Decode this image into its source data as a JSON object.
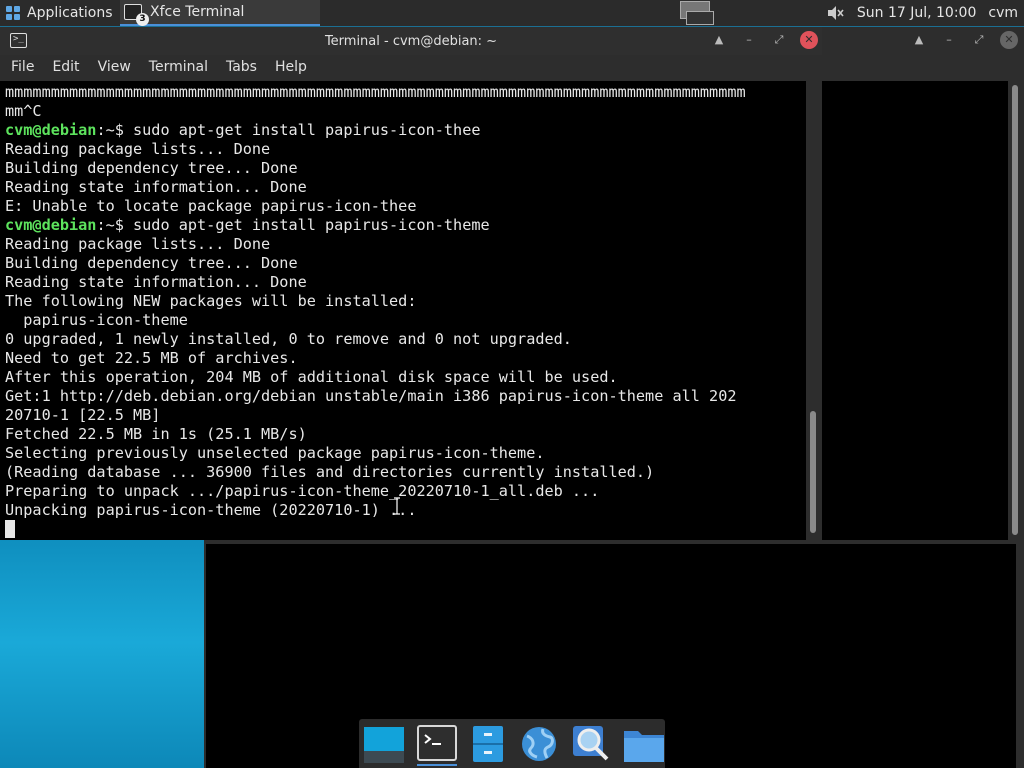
{
  "top_panel": {
    "applications_label": "Applications",
    "task_label": "Xfce Terminal",
    "task_badge": "3",
    "clock": "Sun 17 Jul, 10:00",
    "user": "cvm"
  },
  "window": {
    "title": "Terminal - cvm@debian: ~",
    "menu": [
      "File",
      "Edit",
      "View",
      "Terminal",
      "Tabs",
      "Help"
    ]
  },
  "terminal": {
    "prompt_user": "cvm@debian",
    "prompt_path": ":~",
    "lines": [
      "mmmmmmmmmmmmmmmmmmmmmmmmmmmmmmmmmmmmmmmmmmmmmmmmmmmmmmmmmmmmmmmmmmmmmmmmmmmmmmmmm",
      "mm^C",
      "$ sudo apt-get install papirus-icon-thee",
      "Reading package lists... Done",
      "Building dependency tree... Done",
      "Reading state information... Done",
      "E: Unable to locate package papirus-icon-thee",
      "$ sudo apt-get install papirus-icon-theme",
      "Reading package lists... Done",
      "Building dependency tree... Done",
      "Reading state information... Done",
      "The following NEW packages will be installed:",
      "  papirus-icon-theme",
      "0 upgraded, 1 newly installed, 0 to remove and 0 not upgraded.",
      "Need to get 22.5 MB of archives.",
      "After this operation, 204 MB of additional disk space will be used.",
      "Get:1 http://deb.debian.org/debian unstable/main i386 papirus-icon-theme all 202",
      "20710-1 [22.5 MB]",
      "Fetched 22.5 MB in 1s (25.1 MB/s)",
      "Selecting previously unselected package papirus-icon-theme.",
      "(Reading database ... 36900 files and directories currently installed.)",
      "Preparing to unpack .../papirus-icon-theme_20220710-1_all.deb ...",
      "Unpacking papirus-icon-theme (20220710-1) ..."
    ]
  },
  "dock": {
    "items": [
      "show-desktop-icon",
      "terminal-icon",
      "file-cabinet-icon",
      "web-browser-icon",
      "app-finder-icon",
      "folder-icon"
    ]
  },
  "colors": {
    "prompt_green": "#5de35d",
    "close_red": "#e0525b",
    "accent_blue": "#4a90d9"
  }
}
